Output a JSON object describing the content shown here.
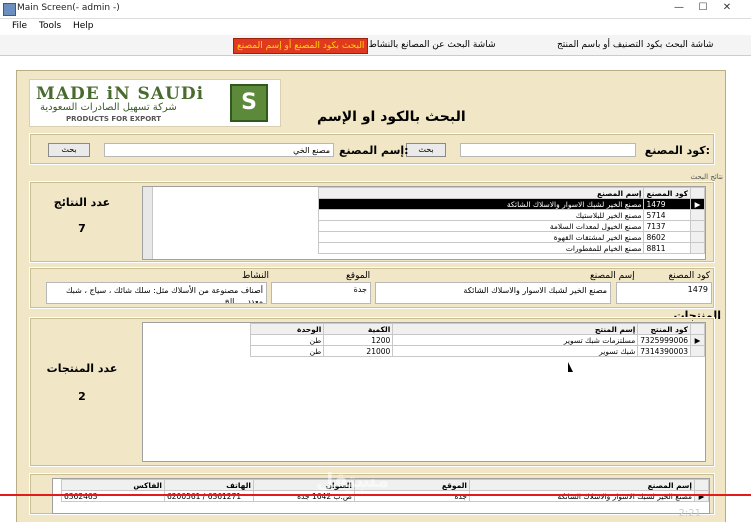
{
  "window": {
    "title": "Main Screen(- admin -)",
    "controls": [
      "—",
      "☐",
      "✕"
    ]
  },
  "menu": [
    "File",
    "Tools",
    "Help"
  ],
  "tabs": [
    "شاشة البحث بكود التصنيف أو باسم المنتج",
    "شاشة البحث عن المصانع بالنشاط أو بالموقع",
    "البحث بكود المصنع أو إسم المصنع"
  ],
  "logo": {
    "made": "MADE iN SAUDi",
    "arabic": "شركة تسهيل الصادرات السعودية",
    "subtitle": "PRODUCTS FOR EXPORT",
    "badge": "S"
  },
  "heading": "البحث بالكود او الإسم",
  "search": {
    "code_label": "كود المصنع:",
    "code_value": "",
    "code_button": "بحث",
    "name_label": "إسم المصنع:",
    "name_value": "مصنع الخي",
    "name_button": "بحث"
  },
  "results_caption": "نتائج البحث",
  "results": {
    "count_label": "عدد النتائج",
    "count": "7",
    "columns": [
      "كود المصنع",
      "إسم المصنع"
    ],
    "rows": [
      [
        "1479",
        "مصنع الخير لشبك الاسوار والاسلاك الشائكة"
      ],
      [
        "5714",
        "مصنع الخير للبلاستيك"
      ],
      [
        "7137",
        "مصنع الخيول لمعدات السلامة"
      ],
      [
        "8602",
        "مصنع الخير لمشتقات القهوة"
      ],
      [
        "8811",
        "مصنع الخيام للمفطورات"
      ]
    ]
  },
  "details": {
    "labels": [
      "كود المصنع",
      "إسم المصنع",
      "الموقع",
      "النشاط"
    ],
    "code": "1479",
    "name": "مصنع الخير لشبك الاسوار والاسلاك الشائكة",
    "location": "جدة",
    "activity": "أصناف مصنوعة من الأسلاك مثل: سلك شائك ، سياج ، شبك معدد ... الخ"
  },
  "products_title": "المنتجات",
  "products": {
    "count_label": "عدد المنتجات",
    "count": "2",
    "columns": [
      "كود المنتج",
      "إسم المنتج",
      "الكمية",
      "الوحدة"
    ],
    "rows": [
      [
        "7325999006",
        "مسلتزمات شبك تسوير",
        "1200",
        "طن"
      ],
      [
        "7314390003",
        "شبك تسوير",
        "21000",
        "طن"
      ]
    ]
  },
  "bottom_grid": {
    "columns": [
      "إسم المصنع",
      "الموقع",
      "العنوان",
      "الهاتف",
      "الفاكس"
    ],
    "row": [
      "مصنع الخير لشبك الاسوار والاسلاك الشائكة",
      "جدة",
      "ص.ب 1642 جدة",
      "6200561 / 6361271",
      "6362463"
    ]
  },
  "watermark": {
    "arabic": "مستقل",
    "latin": "mostaql.com"
  },
  "video_time": "2:21"
}
